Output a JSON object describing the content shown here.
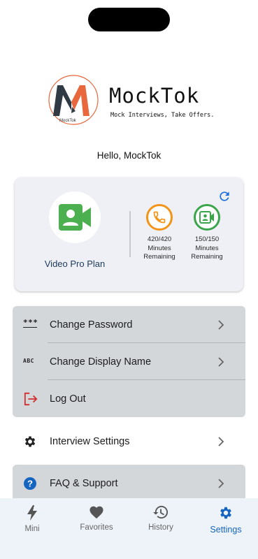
{
  "brand": {
    "logo_caption": "MockTok",
    "app_name": "MockTok",
    "tagline": "Mock Interviews, Take Offers."
  },
  "greeting": "Hello, MockTok",
  "plan": {
    "name": "Video Pro Plan",
    "stats": [
      {
        "icon": "phone-icon",
        "line1": "420/420",
        "line2": "Minutes",
        "line3": "Remaining",
        "color": "#f29418"
      },
      {
        "icon": "video-contact-icon",
        "line1": "150/150",
        "line2": "Minutes",
        "line3": "Remaining",
        "color": "#3aa54a"
      }
    ]
  },
  "account_menu": [
    {
      "icon": "password-icon",
      "glyph": "***",
      "label": "Change Password",
      "chevron": true
    },
    {
      "icon": "abc-icon",
      "glyph": "ABC",
      "label": "Change Display Name",
      "chevron": true
    },
    {
      "icon": "logout-icon",
      "label": "Log Out",
      "chevron": false,
      "color": "#d32f2f"
    }
  ],
  "settings_item": {
    "icon": "gear-icon",
    "label": "Interview Settings"
  },
  "faq_item": {
    "icon": "help-icon",
    "label": "FAQ & Support"
  },
  "tabs": [
    {
      "icon": "bolt-icon",
      "label": "Mini",
      "active": false
    },
    {
      "icon": "heart-icon",
      "label": "Favorites",
      "active": false
    },
    {
      "icon": "history-icon",
      "label": "History",
      "active": false
    },
    {
      "icon": "gear-icon",
      "label": "Settings",
      "active": true
    }
  ],
  "colors": {
    "accent": "#1565c0",
    "card": "#eef0f5",
    "menu": "#d3d7da",
    "green": "#4caf50",
    "orange": "#f29418",
    "logo_orange": "#e8673d",
    "logo_dark": "#2f3a45"
  }
}
